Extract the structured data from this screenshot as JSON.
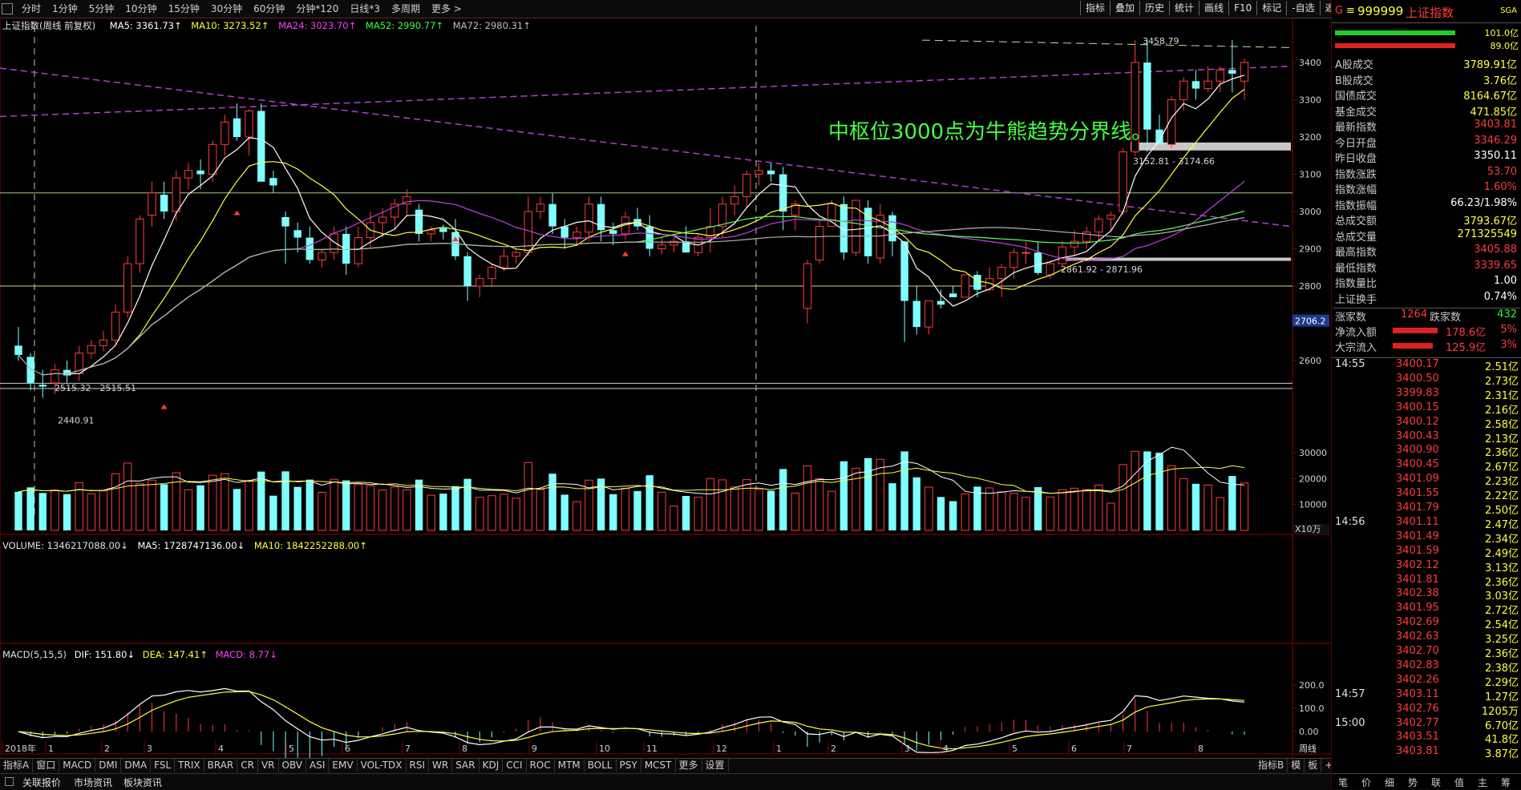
{
  "toolbar": {
    "periods": [
      "分时",
      "1分钟",
      "5分钟",
      "10分钟",
      "15分钟",
      "30分钟",
      "60分钟",
      "分钟*120",
      "日线*3",
      "多周期",
      "更多 >"
    ],
    "tools": [
      "指标",
      "叠加",
      "历史",
      "统计",
      "画线",
      "F10",
      "标记",
      "-自选",
      "返回"
    ]
  },
  "chart": {
    "title": "上证指数(周线 前复权)",
    "ma5": "MA5: 3361.73↑",
    "ma10": "MA10: 3273.52↑",
    "ma24": "MA24: 3023.70↑",
    "ma52": "MA52: 2990.77↑",
    "ma72": "MA72: 2980.31↑",
    "annotation": "中枢位3000点为牛熊趋势分界线。",
    "label_high": "3458.79",
    "label_zone1": "3152.81 - 3174.66",
    "label_zone2": "2861.92 - 2871.96",
    "label_low1": "2515.32 - 2515.51",
    "label_low2": "2440.91",
    "price_ticks": [
      "3400",
      "3300",
      "3200",
      "3100",
      "3000",
      "2900",
      "2800",
      "2700",
      "2600"
    ],
    "crosshair_price": "2706.2",
    "volume_header": "VOLUME: 1346217088.00↓",
    "vol_ma5": "MA5: 1728747136.00↓",
    "vol_ma10": "MA10: 1842252288.00↑",
    "vol_ticks": [
      "30000",
      "20000",
      "10000"
    ],
    "vol_unit": "X10万",
    "macd_header": "MACD(5,15,5)",
    "dif": "DIF: 151.80↓",
    "dea": "DEA: 147.41↑",
    "macd": "MACD: 8.77↓",
    "macd_ticks": [
      "200.0",
      "100.0",
      "0.00"
    ],
    "x_labels": [
      "2018年",
      "1",
      "2",
      "3",
      "4",
      "5",
      "6",
      "7",
      "8",
      "9",
      "10",
      "11",
      "12",
      "1",
      "2",
      "3",
      "4",
      "5",
      "6",
      "7",
      "8"
    ],
    "period_label": "周线"
  },
  "indicator_tabs": [
    "指标A",
    "窗口",
    "MACD",
    "DMI",
    "DMA",
    "FSL",
    "TRIX",
    "BRAR",
    "CR",
    "VR",
    "OBV",
    "ASI",
    "EMV",
    "VOL-TDX",
    "RSI",
    "WR",
    "SAR",
    "KDJ",
    "CCI",
    "ROC",
    "MTM",
    "BOLL",
    "PSY",
    "MCST",
    "更多",
    "设置"
  ],
  "indicator_right": [
    "指标B",
    "模",
    "板",
    "+",
    "-"
  ],
  "status": [
    "关联报价",
    "市场资讯",
    "板块资讯"
  ],
  "right_panel": {
    "code": "999999",
    "name": "上证指数",
    "tag": "SGA",
    "bar_vals": [
      "101.0亿",
      "89.0亿"
    ],
    "stats": [
      {
        "label": "A股成交",
        "value": "3789.91亿",
        "color": "#ffff40"
      },
      {
        "label": "B股成交",
        "value": "3.76亿",
        "color": "#ffff40"
      },
      {
        "label": "国债成交",
        "value": "8164.67亿",
        "color": "#ffff40"
      },
      {
        "label": "基金成交",
        "value": "471.85亿",
        "color": "#ffff40"
      },
      {
        "label": "最新指数",
        "value": "3403.81",
        "color": "#ff3b3b"
      },
      {
        "label": "今日开盘",
        "value": "3346.29",
        "color": "#ff3b3b"
      },
      {
        "label": "昨日收盘",
        "value": "3350.11",
        "color": "#ffffff"
      },
      {
        "label": "指数涨跌",
        "value": "53.70",
        "color": "#ff3b3b"
      },
      {
        "label": "指数涨幅",
        "value": "1.60%",
        "color": "#ff3b3b"
      },
      {
        "label": "指数振幅",
        "value": "66.23/1.98%",
        "color": "#ffffff"
      },
      {
        "label": "总成交额",
        "value": "3793.67亿",
        "color": "#ffff40"
      },
      {
        "label": "总成交量",
        "value": "271325549",
        "color": "#ffff40"
      },
      {
        "label": "最高指数",
        "value": "3405.88",
        "color": "#ff3b3b"
      },
      {
        "label": "最低指数",
        "value": "3339.65",
        "color": "#ff3b3b"
      },
      {
        "label": "指数量比",
        "value": "1.00",
        "color": "#ffffff"
      },
      {
        "label": "上证换手",
        "value": "0.74%",
        "color": "#ffffff"
      }
    ],
    "up_label": "涨家数",
    "up_count": "1264",
    "down_label": "跌家数",
    "down_count": "432",
    "flow1_label": "净流入额",
    "flow1_val": "178.6亿",
    "flow1_pct": "5%",
    "flow2_label": "大宗流入",
    "flow2_val": "125.9亿",
    "flow2_pct": "3%",
    "ticks": [
      {
        "t": "14:55",
        "p": "3400.17",
        "v": "2.51亿"
      },
      {
        "t": "",
        "p": "3400.50",
        "v": "2.73亿"
      },
      {
        "t": "",
        "p": "3399.83",
        "v": "2.31亿"
      },
      {
        "t": "",
        "p": "3400.15",
        "v": "2.16亿"
      },
      {
        "t": "",
        "p": "3400.12",
        "v": "2.58亿"
      },
      {
        "t": "",
        "p": "3400.43",
        "v": "2.13亿"
      },
      {
        "t": "",
        "p": "3400.90",
        "v": "2.36亿"
      },
      {
        "t": "",
        "p": "3400.45",
        "v": "2.67亿"
      },
      {
        "t": "",
        "p": "3401.09",
        "v": "2.23亿"
      },
      {
        "t": "",
        "p": "3401.55",
        "v": "2.22亿"
      },
      {
        "t": "",
        "p": "3401.79",
        "v": "2.50亿"
      },
      {
        "t": "14:56",
        "p": "3401.11",
        "v": "2.47亿"
      },
      {
        "t": "",
        "p": "3401.49",
        "v": "2.34亿"
      },
      {
        "t": "",
        "p": "3401.59",
        "v": "2.49亿"
      },
      {
        "t": "",
        "p": "3402.12",
        "v": "3.13亿"
      },
      {
        "t": "",
        "p": "3401.81",
        "v": "2.36亿"
      },
      {
        "t": "",
        "p": "3402.38",
        "v": "3.03亿"
      },
      {
        "t": "",
        "p": "3401.95",
        "v": "2.72亿"
      },
      {
        "t": "",
        "p": "3402.69",
        "v": "2.54亿"
      },
      {
        "t": "",
        "p": "3402.63",
        "v": "3.25亿"
      },
      {
        "t": "",
        "p": "3402.70",
        "v": "2.36亿"
      },
      {
        "t": "",
        "p": "3402.83",
        "v": "2.38亿"
      },
      {
        "t": "",
        "p": "3402.26",
        "v": "2.29亿"
      },
      {
        "t": "14:57",
        "p": "3403.11",
        "v": "1.27亿"
      },
      {
        "t": "",
        "p": "3402.76",
        "v": "1205万"
      },
      {
        "t": "15:00",
        "p": "3402.77",
        "v": "6.70亿"
      },
      {
        "t": "",
        "p": "3403.51",
        "v": "41.8亿"
      },
      {
        "t": "",
        "p": "3403.81",
        "v": "3.87亿"
      }
    ],
    "bottom_tabs": [
      "笔",
      "价",
      "细",
      "势",
      "联",
      "值",
      "主",
      "筹"
    ]
  }
}
